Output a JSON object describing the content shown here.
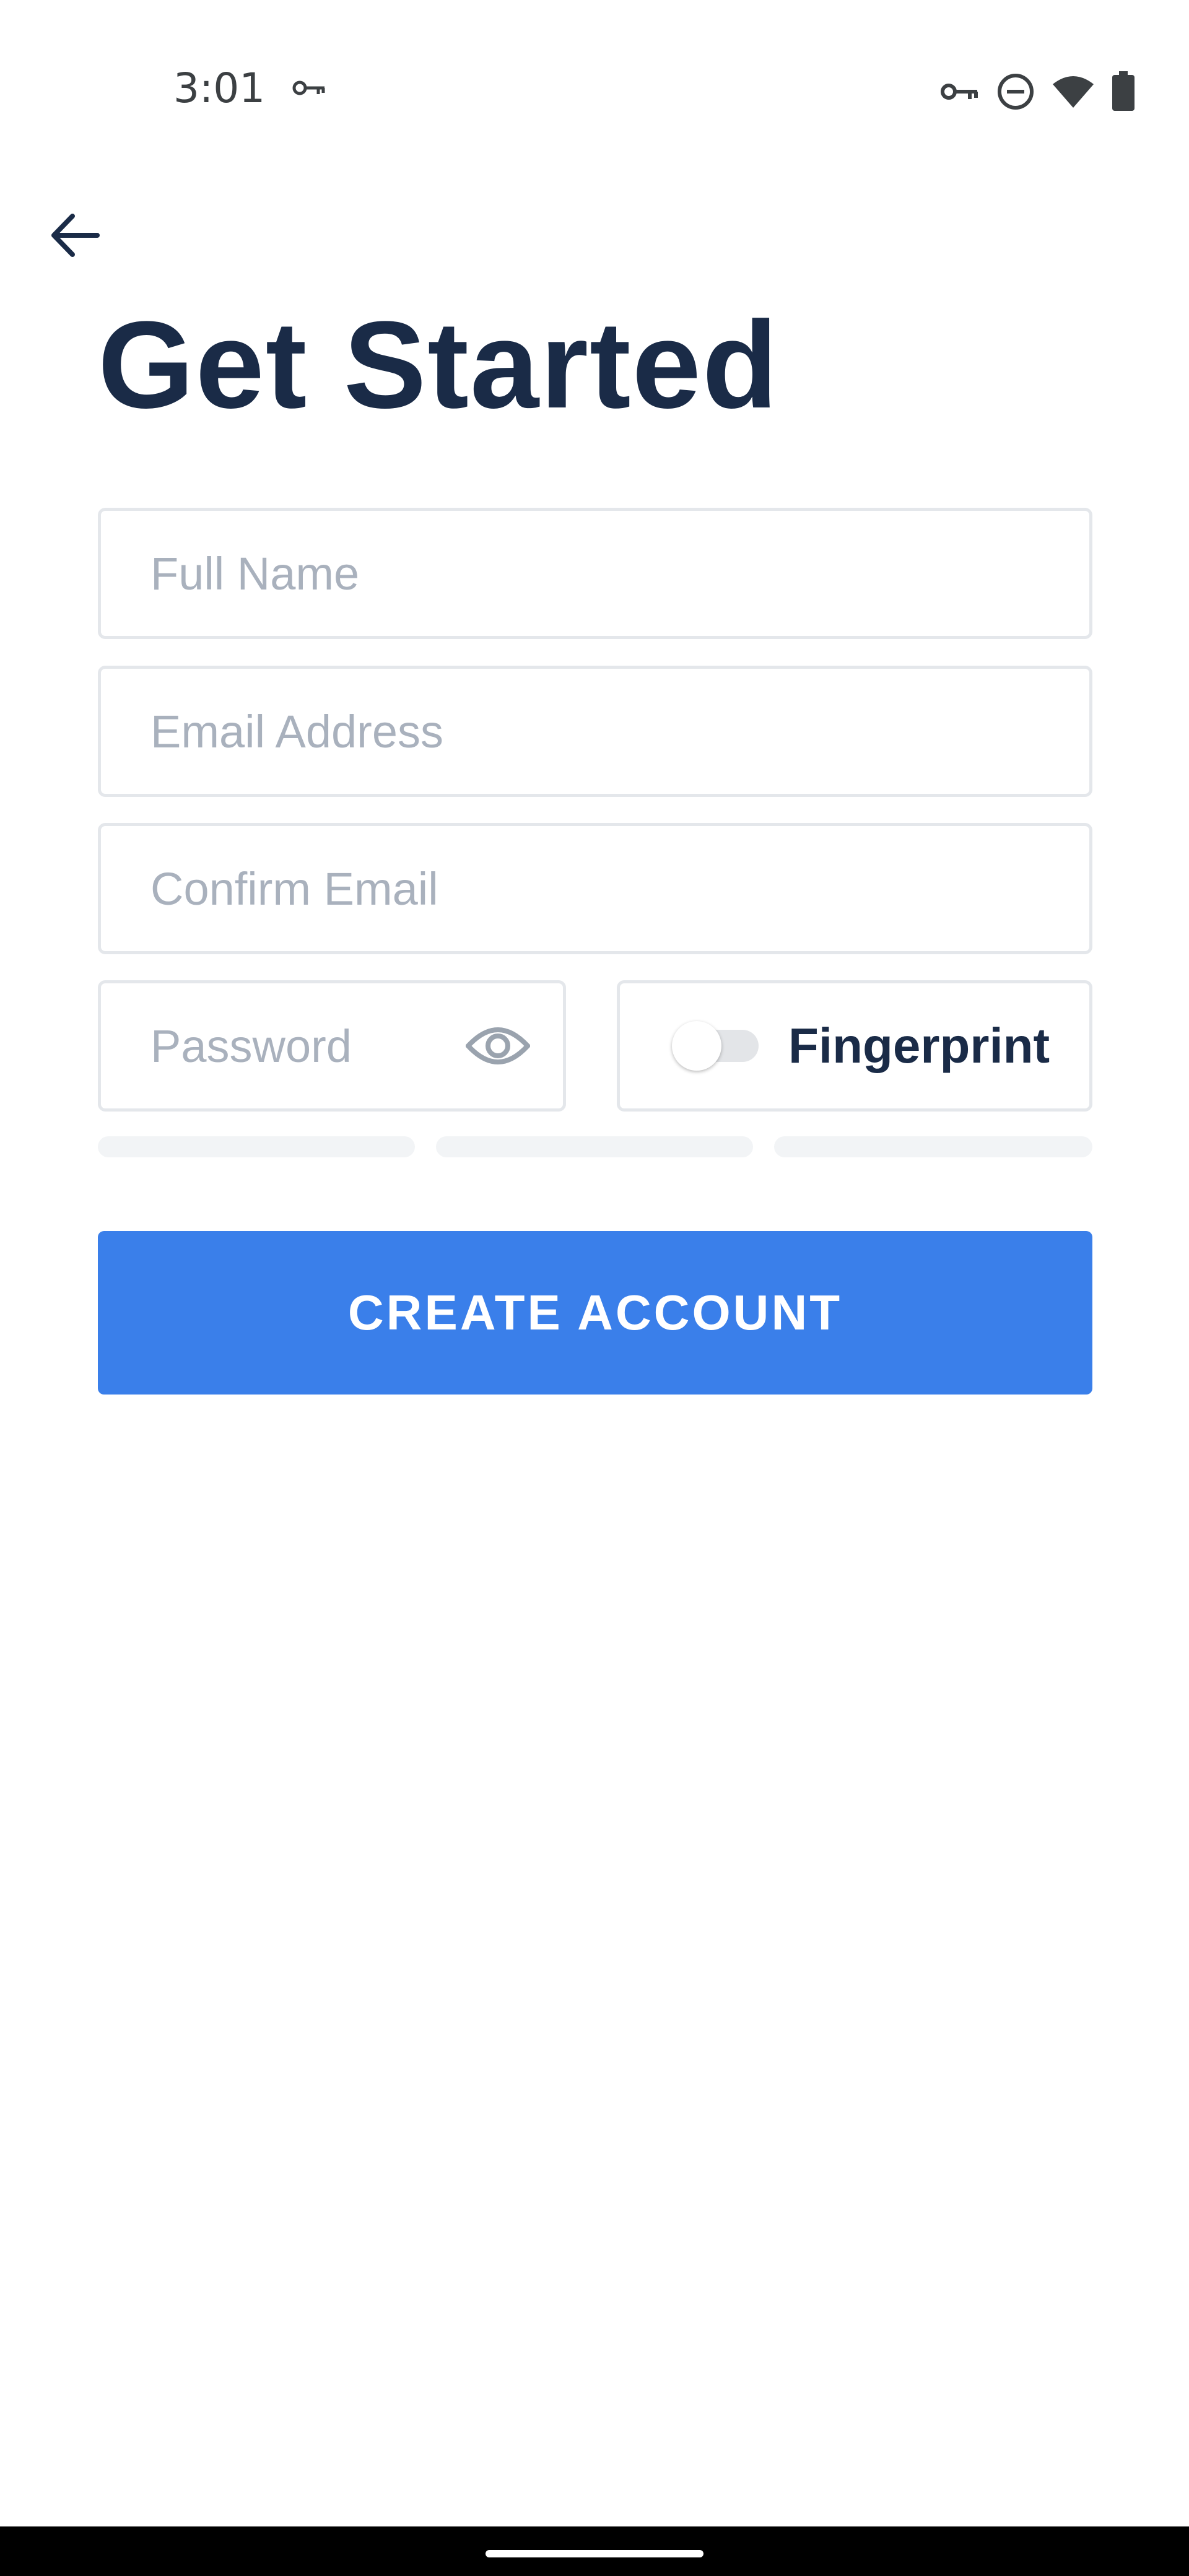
{
  "status_bar": {
    "time": "3:01",
    "icons": [
      "vpn-key-icon",
      "do-not-disturb-icon",
      "wifi-icon",
      "battery-icon"
    ]
  },
  "header": {
    "title": "Get Started"
  },
  "form": {
    "full_name": {
      "placeholder": "Full Name",
      "value": ""
    },
    "email": {
      "placeholder": "Email Address",
      "value": ""
    },
    "confirm_email": {
      "placeholder": "Confirm Email",
      "value": ""
    },
    "password": {
      "placeholder": "Password",
      "value": ""
    },
    "fingerprint": {
      "label": "Fingerprint",
      "enabled": false
    },
    "password_strength": {
      "segments": 3,
      "filled": 0
    },
    "submit_label": "CREATE ACCOUNT"
  },
  "colors": {
    "title": "#1a2b47",
    "placeholder": "#a9b1bd",
    "border": "#e4e7eb",
    "primary": "#3a7fea",
    "strength_empty": "#f2f4f6"
  }
}
